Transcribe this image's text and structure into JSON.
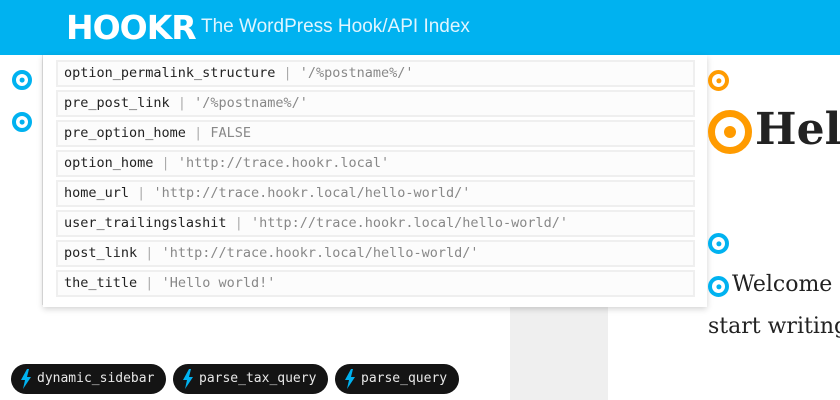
{
  "header": {
    "logo": "HOOKR",
    "tagline": "The WordPress Hook/API Index"
  },
  "colors": {
    "brand": "#00b2f0",
    "accent": "#ff9b00"
  },
  "popup": {
    "rows": [
      {
        "name": "option_permalink_structure",
        "value": "'/%postname%/'"
      },
      {
        "name": "pre_post_link",
        "value": "'/%postname%/'"
      },
      {
        "name": "pre_option_home",
        "value": "FALSE"
      },
      {
        "name": "option_home",
        "value": "'http://trace.hookr.local'"
      },
      {
        "name": "home_url",
        "value": "'http://trace.hookr.local/hello-world/'"
      },
      {
        "name": "user_trailingslashit",
        "value": "'http://trace.hookr.local/hello-world/'"
      },
      {
        "name": "post_link",
        "value": "'http://trace.hookr.local/hello-world/'"
      },
      {
        "name": "the_title",
        "value": "'Hello world!'"
      }
    ],
    "separator": "|"
  },
  "post": {
    "title": "Hel",
    "line1": "Welcome t",
    "line2": "start writing"
  },
  "hook_pills": [
    {
      "label": "dynamic_sidebar",
      "icon": "bolt-icon"
    },
    {
      "label": "parse_tax_query",
      "icon": "bolt-icon"
    },
    {
      "label": "parse_query",
      "icon": "bolt-icon"
    }
  ]
}
